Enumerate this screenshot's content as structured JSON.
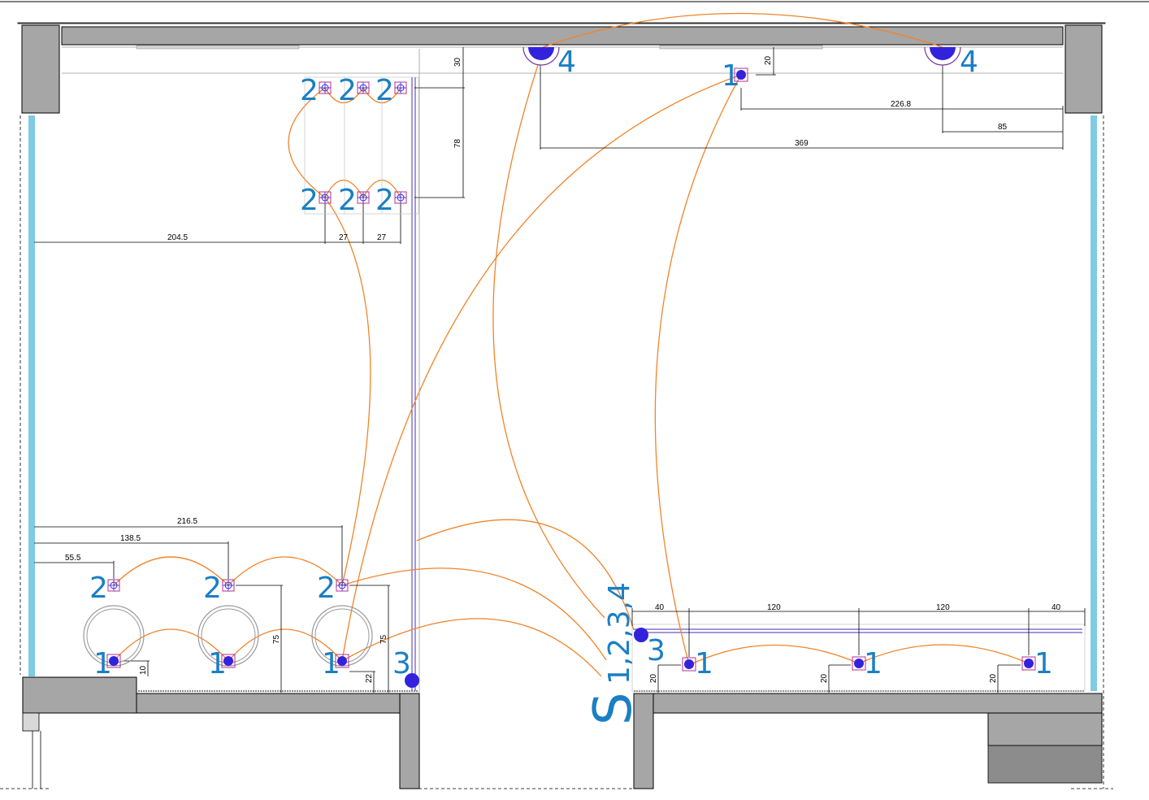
{
  "dimensions": {
    "d30": "30",
    "d20_top": "20",
    "d226": "226.8",
    "d85": "85",
    "d369": "369",
    "d78": "78",
    "d204": "204.5",
    "d27a": "27",
    "d27b": "27",
    "d216": "216.5",
    "d138": "138.5",
    "d55": "55.5",
    "d75a": "75",
    "d75b": "75",
    "d10": "10",
    "d22": "22",
    "d40a": "40",
    "d120a": "120",
    "d120b": "120",
    "d40b": "40",
    "d20a": "20",
    "d20b": "20",
    "d20c": "20"
  },
  "fixture_labels": {
    "n1": "1",
    "n2": "2",
    "n3": "3",
    "n4": "4"
  },
  "switch": {
    "letter": "S",
    "circuits": "1,2,3,4"
  },
  "colors": {
    "wire": "#f0842a",
    "fixture": "#3322dd",
    "label": "#1a7fc4",
    "window": "#7ecbe3",
    "wall": "#a6a6a6"
  }
}
